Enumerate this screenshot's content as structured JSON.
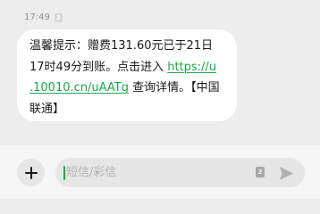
{
  "message": {
    "time": "17:49",
    "sim_badge": "2",
    "lines": [
      {
        "text": "温馨提示：赠费131.60元已于21日"
      },
      {
        "text_before": "17时49分到账。点击进入 ",
        "link": "https://u"
      },
      {
        "link": ".10010.cn/uAATg",
        "text_after": " 查询详情。【中国"
      },
      {
        "text": "联通】"
      }
    ]
  },
  "composer": {
    "placeholder": "短信/彩信",
    "sim_label": "2",
    "add_icon": "plus-icon",
    "send_icon": "send-arrow-icon"
  },
  "colors": {
    "background": "#ededed",
    "bubble": "#ffffff",
    "link": "#1aa84f",
    "composer": "#f6f6f6",
    "input": "#e6e6e6"
  }
}
